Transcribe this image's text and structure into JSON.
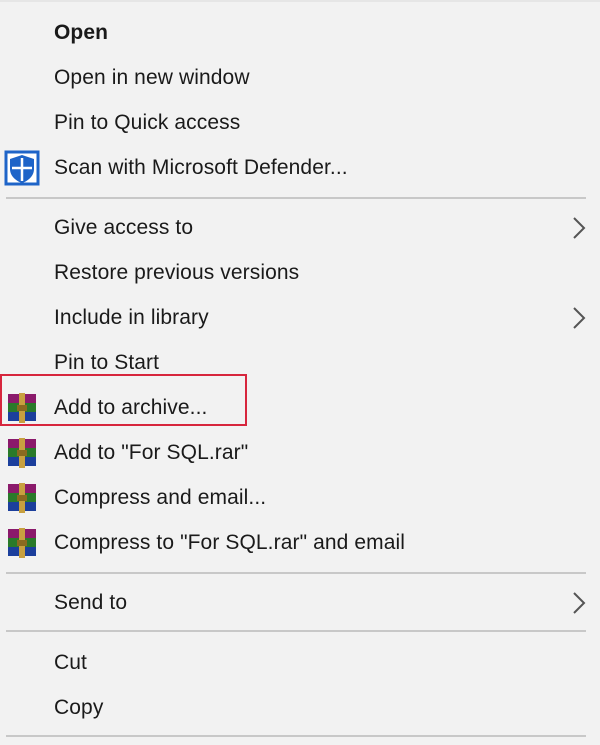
{
  "menu": {
    "items": [
      {
        "label": "Open",
        "bold": true
      },
      {
        "label": "Open in new window"
      },
      {
        "label": "Pin to Quick access"
      },
      {
        "label": "Scan with Microsoft Defender...",
        "icon": "defender-shield-icon"
      },
      {
        "label": "Give access to",
        "submenu": true
      },
      {
        "label": "Restore previous versions"
      },
      {
        "label": "Include in library",
        "submenu": true
      },
      {
        "label": "Pin to Start"
      },
      {
        "label": "Add to archive...",
        "icon": "winrar-icon",
        "highlighted": true
      },
      {
        "label": "Add to \"For SQL.rar\"",
        "icon": "winrar-icon"
      },
      {
        "label": "Compress and email...",
        "icon": "winrar-icon"
      },
      {
        "label": "Compress to \"For SQL.rar\" and email",
        "icon": "winrar-icon"
      },
      {
        "label": "Send to",
        "submenu": true
      },
      {
        "label": "Cut"
      },
      {
        "label": "Copy"
      }
    ]
  },
  "colors": {
    "highlight_border": "#d7263d",
    "menu_background": "#f2f2f2",
    "separator": "#c8c8c8",
    "defender_blue": "#1e64c8"
  }
}
